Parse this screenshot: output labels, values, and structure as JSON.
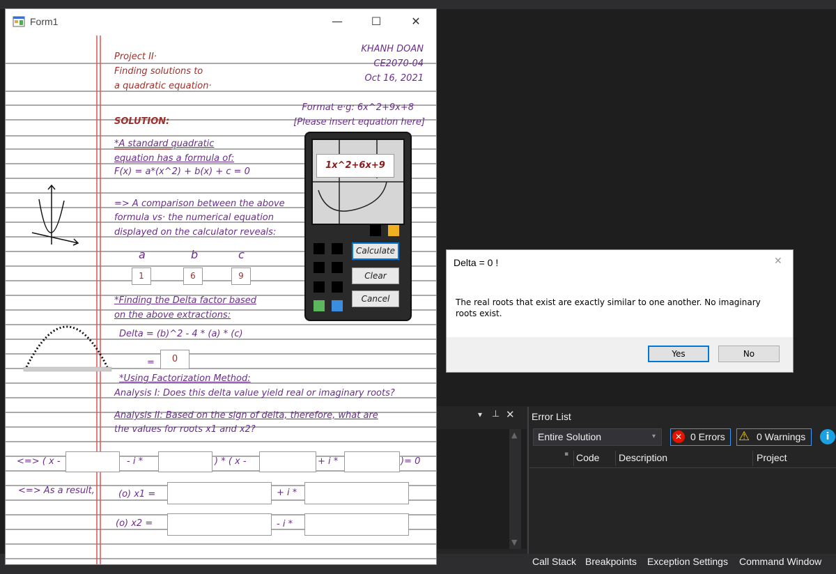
{
  "form": {
    "title": "Form1",
    "header_left": [
      "Project II·",
      "Finding solutions to",
      "a quadratic equation·"
    ],
    "header_right": [
      "KHANH DOAN",
      "CE2070-04",
      "Oct 16, 2021"
    ],
    "format_hint": "Format e·g: 6x^2+9x+8",
    "insert_hint": "[Please insert equation here]",
    "solution_label": "SOLUTION:",
    "standard_lines": [
      "*A standard quadratic",
      "equation has a formula of:",
      "F(x) = a*(x^2) + b(x) + c = 0"
    ],
    "comparison_lines": [
      "=> A comparison between the above",
      "formula vs· the numerical equation",
      "displayed on the calculator reveals:"
    ],
    "coef_labels": [
      "a",
      "b",
      "c"
    ],
    "coef_values": [
      "1",
      "6",
      "9"
    ],
    "delta_intro": [
      "*Finding the Delta factor based",
      "on the above extractions:"
    ],
    "delta_formula": "Delta = (b)^2 - 4 * (a) * (c)",
    "delta_eq": "=",
    "delta_value": "0",
    "factorization_label": "*Using Factorization Method:",
    "analysis1": "Analysis I: Does this delta value yield real or imaginary roots?",
    "analysis2": [
      "Analysis II: Based on the sign of delta, therefore, what are",
      "the values for roots x1 and x2?"
    ],
    "factor_row": {
      "prefix": "<=> ( x -",
      "minus_i": "- i *",
      "mid": ") * ( x -",
      "plus_i": "+ i *",
      "end": ")= 0"
    },
    "result_label": "<=> As a result,",
    "x1_label": "(o) x1 =",
    "x1_op": "+ i *",
    "x2_label": "(o) x2 =",
    "x2_op": "- i *",
    "calculator": {
      "display": "1x^2+6x+9",
      "calculate": "Calculate",
      "clear": "Clear",
      "cancel": "Cancel"
    }
  },
  "dialog": {
    "title": "Delta = 0 !",
    "message": "The real roots that exist are exactly similar to one another. No imaginary roots exist.",
    "yes": "Yes",
    "no": "No"
  },
  "error_list": {
    "title": "Error List",
    "scope": "Entire Solution",
    "errors": "0 Errors",
    "warnings": "0 Warnings",
    "columns": [
      "Code",
      "Description",
      "Project"
    ]
  },
  "bottom_tabs": [
    "Call Stack",
    "Breakpoints",
    "Exception Settings",
    "Command Window"
  ],
  "colors": {
    "ink": "#6b2d8c",
    "margin_red": "#e05050",
    "accent_blue": "#0078d7"
  }
}
